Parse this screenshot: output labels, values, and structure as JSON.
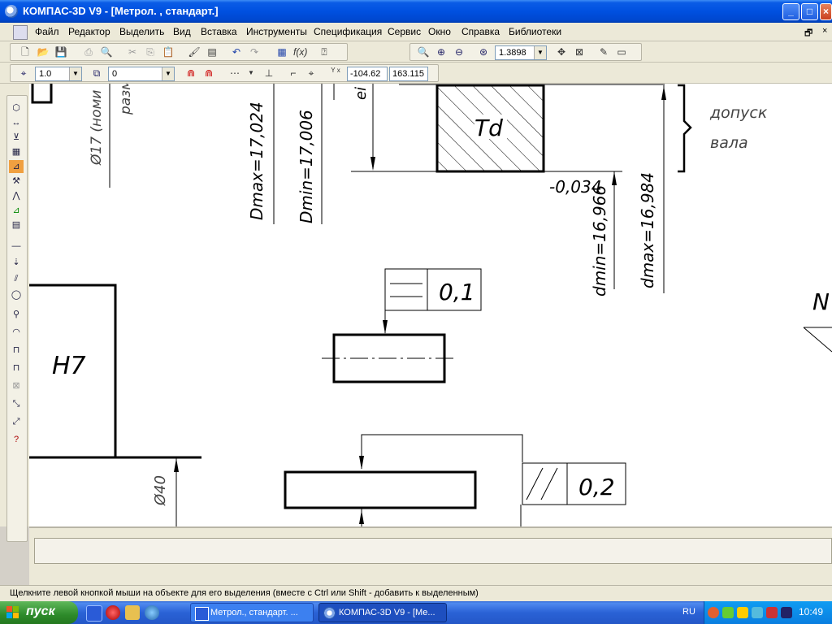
{
  "window": {
    "title": "КОМПАС-3D V9 - [Метрол. , стандарт.]",
    "buttons": {
      "minimize": "_",
      "maximize": "□",
      "close": "×"
    }
  },
  "menu": {
    "items": [
      "Файл",
      "Редактор",
      "Выделить",
      "Вид",
      "Вставка",
      "Инструменты",
      "Спецификация",
      "Сервис",
      "Окно",
      "Справка",
      "Библиотеки"
    ],
    "mdi_restore": "🗗",
    "mdi_close": "×"
  },
  "toolbar": {
    "zoom_value": "1.3898",
    "line_scale": "1.0",
    "layer": "0",
    "coord_x": "-104.62",
    "coord_y": "163.115",
    "coord_label": "Y x"
  },
  "drawing": {
    "labels": {
      "d17_nominal": "Ø17 (номи",
      "raz": "разм",
      "ei": "ei",
      "td": "Td",
      "dopusk": "допуск",
      "vala": "вала",
      "dmax_hole": "Dmax=17,024",
      "dmin_hole": "Dmin=17,006",
      "dev_lower": "-0,034",
      "dmin_shaft": "dmin=16,966",
      "dmax_shaft": "dmax=16,984",
      "tol_flat": "0,1",
      "tol_parallel": "0,2",
      "h7": "H7",
      "d40": "Ø40",
      "n_partial": "N"
    }
  },
  "status_text": "Щелкните левой кнопкой мыши на объекте для его выделения (вместе с Ctrl или Shift - добавить к выделенным)",
  "taskbar": {
    "start": "пуск",
    "tasks": [
      "Метрол., стандарт. ...",
      "КОМПАС-3D V9 - [Ме..."
    ],
    "lang": "RU",
    "clock": "10:49"
  }
}
